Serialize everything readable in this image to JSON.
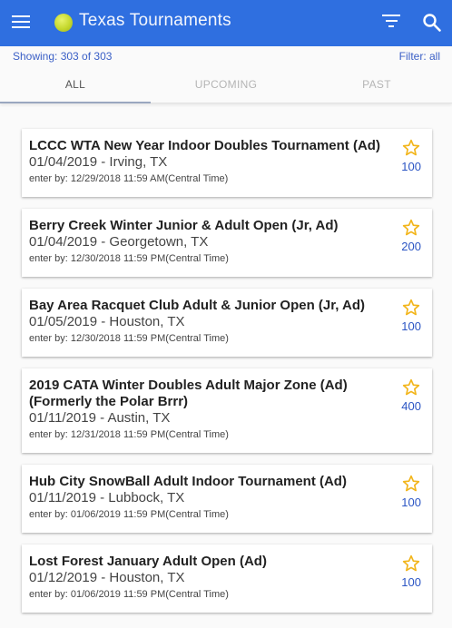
{
  "header": {
    "title": "Texas Tournaments",
    "icons": {
      "menu": "menu-icon",
      "logo": "tennis-ball-icon",
      "filter": "filter-icon",
      "search": "search-icon"
    }
  },
  "info": {
    "showing": "Showing: 303 of 303",
    "filter": "Filter: all"
  },
  "tabs": [
    {
      "label": "ALL",
      "active": true
    },
    {
      "label": "UPCOMING",
      "active": false
    },
    {
      "label": "PAST",
      "active": false
    }
  ],
  "colors": {
    "appbar": "#2f6fe0",
    "star": "#f2b51b",
    "points": "#2b55c4"
  },
  "tournaments": [
    {
      "name": "LCCC WTA New Year Indoor Doubles Tournament (Ad)",
      "date_location": "01/04/2019 - Irving, TX",
      "deadline": "enter by: 12/29/2018 11:59 AM(Central Time)",
      "points": "100"
    },
    {
      "name": "Berry Creek Winter Junior & Adult Open (Jr, Ad)",
      "date_location": "01/04/2019 - Georgetown, TX",
      "deadline": "enter by: 12/30/2018 11:59 PM(Central Time)",
      "points": "200"
    },
    {
      "name": "Bay Area Racquet Club Adult & Junior Open (Jr, Ad)",
      "date_location": "01/05/2019 - Houston, TX",
      "deadline": "enter by: 12/30/2018 11:59 PM(Central Time)",
      "points": "100"
    },
    {
      "name": "2019 CATA Winter Doubles Adult Major Zone (Ad) (Formerly the Polar Brrr)",
      "date_location": "01/11/2019 - Austin, TX",
      "deadline": "enter by: 12/31/2018 11:59 PM(Central Time)",
      "points": "400"
    },
    {
      "name": "Hub City SnowBall Adult Indoor Tournament (Ad)",
      "date_location": "01/11/2019 - Lubbock, TX",
      "deadline": "enter by: 01/06/2019 11:59 PM(Central Time)",
      "points": "100"
    },
    {
      "name": "Lost Forest January Adult Open (Ad)",
      "date_location": "01/12/2019 - Houston, TX",
      "deadline": "enter by: 01/06/2019 11:59 PM(Central Time)",
      "points": "100"
    }
  ]
}
